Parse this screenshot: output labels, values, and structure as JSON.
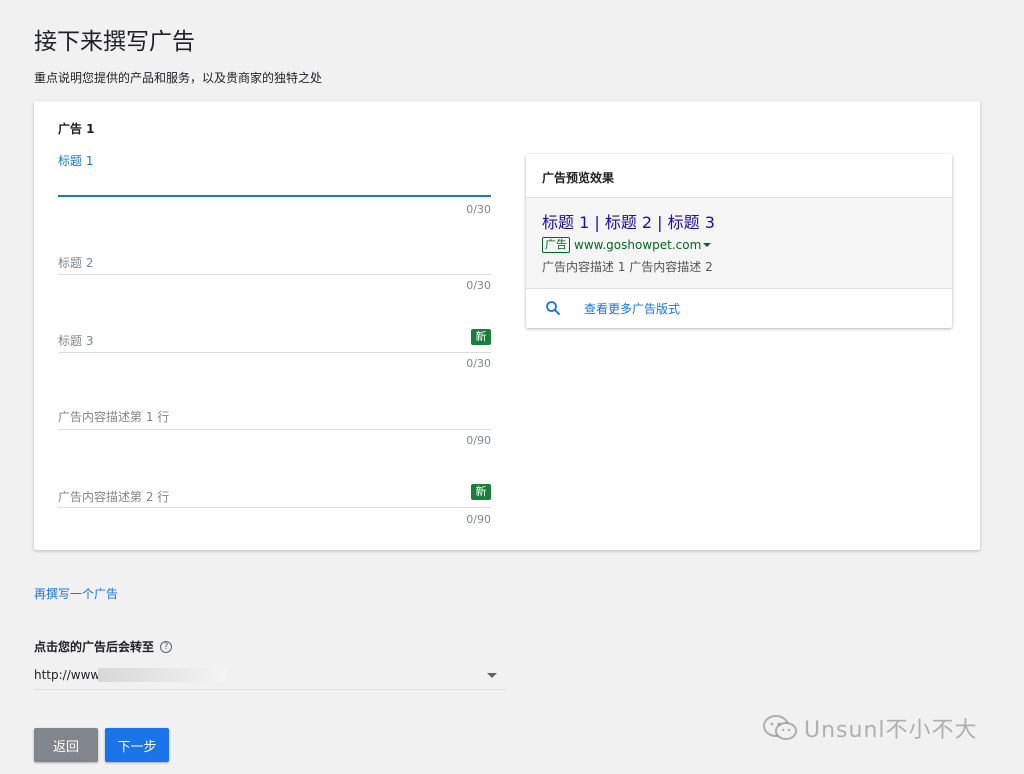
{
  "page": {
    "title": "接下来撰写广告",
    "subtitle": "重点说明您提供的产品和服务，以及贵商家的独特之处"
  },
  "ad": {
    "heading": "广告 1",
    "fields": [
      {
        "label": "标题 1",
        "counter": "0/30"
      },
      {
        "label": "标题 2",
        "counter": "0/30"
      },
      {
        "label": "标题 3",
        "counter": "0/30",
        "badge": "新"
      },
      {
        "label": "广告内容描述第 1 行",
        "counter": "0/90"
      },
      {
        "label": "广告内容描述第 2 行",
        "counter": "0/90",
        "badge": "新"
      }
    ]
  },
  "preview": {
    "header": "广告预览效果",
    "headline": "标题 1 | 标题 2 | 标题 3",
    "ad_tag": "广告",
    "url": "www.goshowpet.com",
    "description": "广告内容描述 1 广告内容描述 2",
    "more_formats": "查看更多广告版式"
  },
  "another_ad_link": "再撰写一个广告",
  "destination": {
    "label": "点击您的广告后会转至",
    "help": "?",
    "value": "http://www"
  },
  "buttons": {
    "back": "返回",
    "next": "下一步"
  },
  "watermark": "Unsunl不小不大",
  "colors": {
    "primary": "#1a73e8",
    "badge_green": "#188038",
    "headline_link": "#1a0dab",
    "url_green": "#006621"
  }
}
